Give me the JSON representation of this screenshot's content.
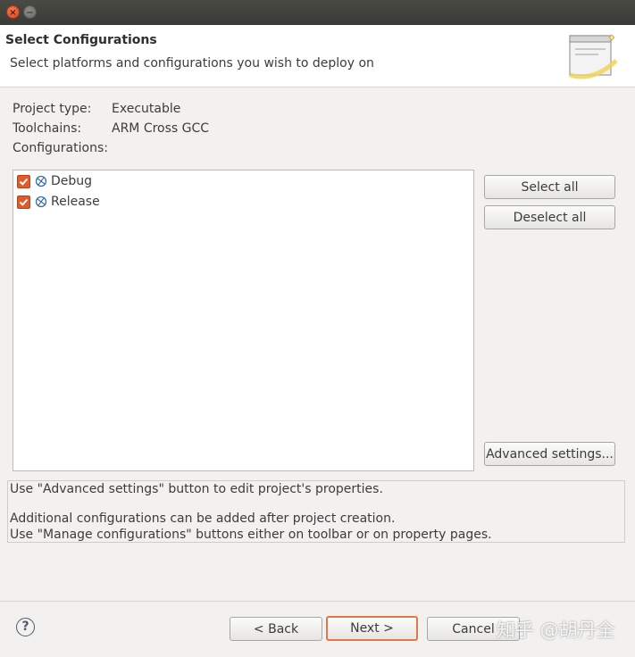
{
  "window": {
    "close_glyph": "×",
    "minimize_glyph": "−"
  },
  "header": {
    "title": "Select Configurations",
    "description": "Select platforms and configurations you wish to deploy on"
  },
  "project_info": {
    "type_label": "Project type:",
    "type_value": "Executable",
    "toolchains_label": "Toolchains:",
    "toolchains_value": "ARM Cross GCC",
    "configurations_label": "Configurations:"
  },
  "configurations": [
    {
      "label": "Debug",
      "checked": true
    },
    {
      "label": "Release",
      "checked": true
    }
  ],
  "side_buttons": {
    "select_all": "Select all",
    "deselect_all": "Deselect all",
    "advanced_settings": "Advanced settings..."
  },
  "messages": {
    "line1": "Use \"Advanced settings\" button to edit project's properties.",
    "line2": "Additional configurations can be added after project creation.",
    "line3": "Use \"Manage configurations\" buttons either on toolbar or on property pages."
  },
  "footer": {
    "help_glyph": "?",
    "back": "< Back",
    "next": "Next >",
    "cancel": "Cancel"
  },
  "watermark": "知乎 @胡丹全",
  "colors": {
    "checkbox": "#e05a2a",
    "primary_border": "#e0784a",
    "titlebar": "#3f3f3b"
  }
}
